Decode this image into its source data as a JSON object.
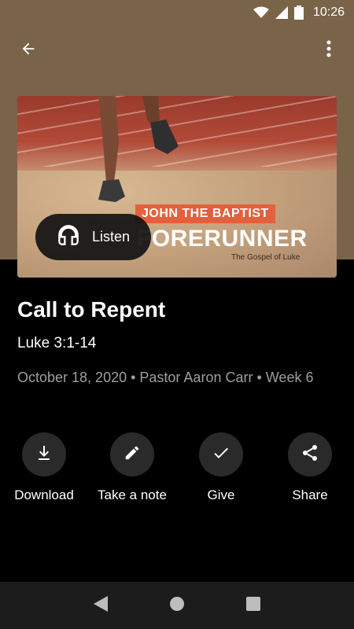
{
  "status_bar": {
    "time": "10:26",
    "icons": [
      "wifi-icon",
      "cell-signal-icon",
      "battery-icon"
    ]
  },
  "app_bar": {
    "back_icon": "arrow-back-icon",
    "menu_icon": "more-vert-icon"
  },
  "artwork": {
    "label_top": "JOHN THE BAPTIST",
    "label_main": "FORERUNNER",
    "label_sub": "The Gospel of Luke"
  },
  "listen_button": {
    "icon": "headphones-icon",
    "label": "Listen"
  },
  "sermon": {
    "title": "Call to Repent",
    "scripture": "Luke 3:1-14",
    "meta": "October 18, 2020 • Pastor Aaron Carr • Week 6"
  },
  "actions": [
    {
      "label": "Download",
      "icon": "download-icon"
    },
    {
      "label": "Take a note",
      "icon": "pencil-icon"
    },
    {
      "label": "Give",
      "icon": "checkmark-icon"
    },
    {
      "label": "Share",
      "icon": "share-icon"
    }
  ],
  "colors": {
    "header_band": "#7a6449",
    "background": "#000000",
    "meta_text": "#9e9e9e",
    "action_circle": "#2a2a2a",
    "nav_bar": "#1c1c1c"
  },
  "nav_bar": {
    "icons": [
      "nav-back-icon",
      "nav-home-icon",
      "nav-recents-icon"
    ]
  }
}
